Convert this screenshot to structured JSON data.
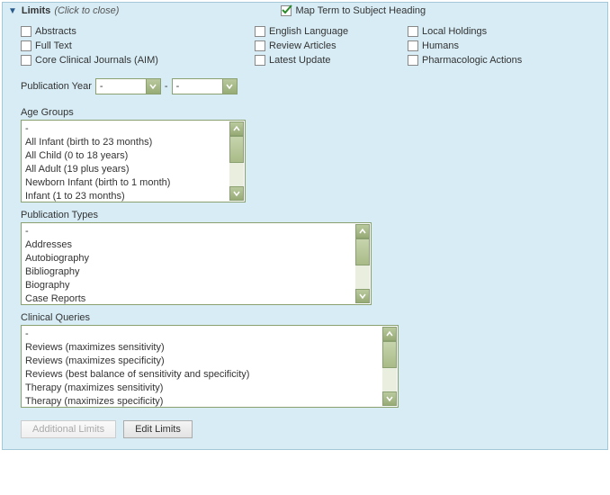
{
  "header": {
    "title": "Limits",
    "hint": "(Click to close)",
    "map_label": "Map Term to Subject Heading",
    "map_checked": true
  },
  "checkboxes": {
    "col0": [
      {
        "label": "Abstracts"
      },
      {
        "label": "Full Text"
      },
      {
        "label": "Core Clinical Journals (AIM)"
      }
    ],
    "col1": [
      {
        "label": "English Language"
      },
      {
        "label": "Review Articles"
      },
      {
        "label": "Latest Update"
      }
    ],
    "col2": [
      {
        "label": "Local Holdings"
      },
      {
        "label": "Humans"
      },
      {
        "label": "Pharmacologic Actions"
      }
    ]
  },
  "pubyear": {
    "label": "Publication Year",
    "from": "-",
    "to": "-",
    "sep": "-"
  },
  "age_groups": {
    "label": "Age Groups",
    "items": [
      "-",
      "All Infant (birth to 23 months)",
      "All Child (0 to 18 years)",
      "All Adult (19 plus years)",
      "Newborn Infant (birth to 1 month)",
      "Infant (1 to 23 months)"
    ]
  },
  "pub_types": {
    "label": "Publication Types",
    "items": [
      "-",
      "Addresses",
      "Autobiography",
      "Bibliography",
      "Biography",
      "Case Reports"
    ]
  },
  "clinical": {
    "label": "Clinical Queries",
    "items": [
      "-",
      "Reviews (maximizes sensitivity)",
      "Reviews (maximizes specificity)",
      "Reviews (best balance of sensitivity and specificity)",
      "Therapy (maximizes sensitivity)",
      "Therapy (maximizes specificity)"
    ]
  },
  "buttons": {
    "additional": "Additional Limits",
    "edit": "Edit Limits"
  }
}
